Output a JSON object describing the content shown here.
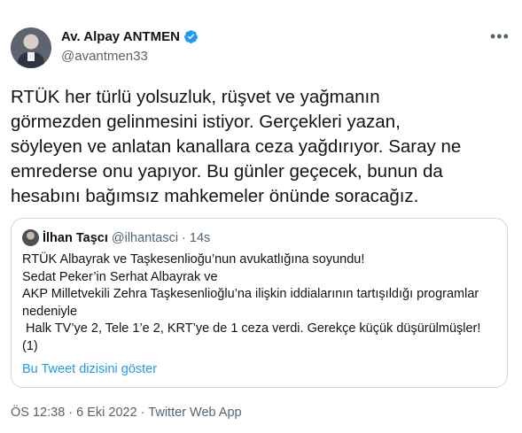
{
  "author": {
    "name": "Av. Alpay ANTMEN",
    "handle": "@avantmen33",
    "verified_icon": "verified-badge-icon",
    "more_icon": "more-options-icon"
  },
  "tweet": {
    "lines": [
      "RTÜK her türlü yolsuzluk, rüşvet ve yağmanın",
      "görmezden gelinmesini istiyor. Gerçekleri yazan,",
      "söyleyen ve anlatan  kanallara ceza yağdırıyor. Saray ne",
      "emrederse onu yapıyor. Bu günler geçecek, bunun da",
      "hesabını bağımsız mahkemeler önünde soracağız."
    ]
  },
  "quoted": {
    "name": "İlhan Taşcı",
    "handle": "@ilhantasci",
    "separator": "·",
    "time": "14s",
    "lines": [
      "RTÜK Albayrak ve Taşkesenlioğu’nun avukatlığına soyundu!",
      "Sedat Peker’in Serhat Albayrak ve",
      "AKP Milletvekili Zehra Taşkesenlioğlu’na ilişkin iddialarının tartışıldığı programlar",
      "nedeniyle",
      " Halk TV’ye 2, Tele 1’e 2, KRT’ye de 1 ceza verdi. Gerekçe küçük düşürülmüşler!",
      "(1)"
    ],
    "thread_link": "Bu Tweet dizisini göster"
  },
  "meta": {
    "text": "ÖS 12:38 · 6 Eki 2022 · Twitter Web App"
  },
  "colors": {
    "accent": "#1d9bf0",
    "text": "#0f1419",
    "secondary": "#536471",
    "border": "#cfd9de"
  }
}
